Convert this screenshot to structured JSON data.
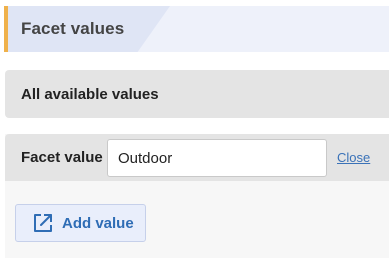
{
  "header": {
    "title": "Facet values",
    "accent_color": "#efb14b"
  },
  "all_values": {
    "label": "All available values"
  },
  "editor": {
    "field_label": "Facet value",
    "input_value": "Outdoor",
    "close_label": "Close"
  },
  "actions": {
    "add_value_label": "Add value",
    "add_value_icon": "external-link-icon"
  }
}
